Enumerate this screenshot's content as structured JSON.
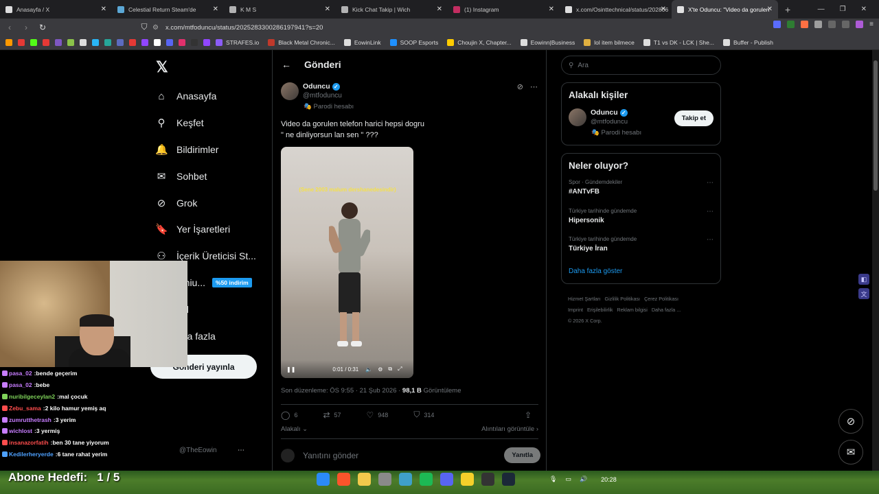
{
  "browser": {
    "tabs": [
      {
        "title": "Anasayfa / X",
        "icon": "x-logo-icon",
        "color": "#ffffff"
      },
      {
        "title": "Celestial Return Steam'de",
        "icon": "steam-icon",
        "color": "#66c0f4"
      },
      {
        "title": "K M S",
        "icon": "globe-icon",
        "color": "#cccccc"
      },
      {
        "title": "Kick Chat Takip | Wich",
        "icon": "globe-icon",
        "color": "#cccccc"
      },
      {
        "title": "(1) Instagram",
        "icon": "instagram-icon",
        "color": "#e1306c"
      },
      {
        "title": "x.com/Osinttechnical/status/202806",
        "icon": "x-logo-icon",
        "color": "#ffffff"
      },
      {
        "title": "X'te Oduncu: \"Video da gorulen",
        "icon": "x-logo-icon",
        "color": "#ffffff",
        "active": true
      }
    ],
    "url": "x.com/mtfoduncu/status/2025283300286197941?s=20",
    "bookmarks": [
      {
        "label": "STRAFES.io",
        "color": "#8b5cf6"
      },
      {
        "label": "Black Metal Chronic...",
        "color": "#c0392b"
      },
      {
        "label": "EowinLink",
        "color": "#dddddd"
      },
      {
        "label": "SOOP Esports",
        "color": "#1e90ff"
      },
      {
        "label": "Choujin X, Chapter...",
        "color": "#ffcc00"
      },
      {
        "label": "Eowinn|Business",
        "color": "#dddddd"
      },
      {
        "label": "lol item bilmece",
        "color": "#e0b040"
      },
      {
        "label": "T1 vs DK - LCK | She...",
        "color": "#dddddd"
      },
      {
        "label": "Buffer - Publish",
        "color": "#dddddd"
      }
    ]
  },
  "sidebar": {
    "items": [
      {
        "label": "Anasayfa",
        "icon": "home-icon",
        "glyph": "⌂"
      },
      {
        "label": "Keşfet",
        "icon": "search-icon",
        "glyph": "⚲"
      },
      {
        "label": "Bildirimler",
        "icon": "bell-icon",
        "glyph": "🔔"
      },
      {
        "label": "Sohbet",
        "icon": "mail-icon",
        "glyph": "✉"
      },
      {
        "label": "Grok",
        "icon": "grok-icon",
        "glyph": "⊘"
      },
      {
        "label": "Yer İşaretleri",
        "icon": "bookmark-icon",
        "glyph": "🔖"
      },
      {
        "label": "İçerik Üreticisi St...",
        "icon": "creator-icon",
        "glyph": "⚇"
      },
      {
        "label": "emiu...",
        "icon": "premium-icon",
        "glyph": "X",
        "badge": "%50 indirim"
      },
      {
        "label": "ofil",
        "icon": "profile-icon",
        "glyph": "☺"
      },
      {
        "label": "aha fazla",
        "icon": "more-icon",
        "glyph": "⋯"
      }
    ],
    "post_button": "Gönderi yayınla",
    "account_handle": "@TheEowin"
  },
  "main": {
    "header": "Gönderi",
    "author": {
      "name": "Oduncu",
      "handle": "@mtfoduncu",
      "parody": "Parodi hesabı"
    },
    "text": "Video da gorulen telefon harici hepsi dogru\n\" ne dinliyorsun lan sen \" ???",
    "video": {
      "caption": "(Sene 2003 malum dershanedesindir)",
      "time": "0:01 / 0:31"
    },
    "meta_date": "Son düzenleme: ÖS 9:55 · 21 Şub 2026 ·",
    "meta_views_count": "98,1 B",
    "meta_views_label": "Görüntüleme",
    "actions": {
      "replies": "6",
      "reposts": "57",
      "likes": "948",
      "bookmarks": "314"
    },
    "related_label": "Alakalı",
    "quotes_label": "Alıntıları görüntüle",
    "reply_placeholder": "Yanıtını gönder",
    "reply_button": "Yanıtla"
  },
  "right": {
    "search_placeholder": "Ara",
    "related_title": "Alakalı kişiler",
    "related_person": {
      "name": "Oduncu",
      "handle": "@mtfoduncu",
      "parody": "Parodi hesabı",
      "follow": "Takip et"
    },
    "trends_title": "Neler oluyor?",
    "trends": [
      {
        "category": "Spor · Gündemdekiler",
        "topic": "#ANTvFB"
      },
      {
        "category": "Türkiye tarihinde gündemde",
        "topic": "Hipersonik"
      },
      {
        "category": "Türkiye tarihinde gündemde",
        "topic": "Türkiye İran"
      }
    ],
    "show_more": "Daha fazla göster",
    "footer": [
      "Hizmet Şartları",
      "Gizlilik Politikası",
      "Çerez Politikası",
      "Imprint",
      "Erişilebilirlik",
      "Reklam bilgisi",
      "Daha fazla ...",
      "© 2026 X Corp."
    ]
  },
  "chat": {
    "lines": [
      {
        "user": "pasa_02",
        "msg": "bende geçerim",
        "color": "#c77dff"
      },
      {
        "user": "pasa_02",
        "msg": "bebe",
        "color": "#c77dff"
      },
      {
        "user": "nuribilgeceylan2",
        "msg": "mal çocuk",
        "color": "#7fd35a"
      },
      {
        "user": "Zebu_sama",
        "msg": "2 kilo hamur yemiş aq",
        "color": "#ff4d4d"
      },
      {
        "user": "zumrutthetrash",
        "msg": "3 yerim",
        "color": "#c77dff"
      },
      {
        "user": "wichlost",
        "msg": "3 yermiş",
        "color": "#c77dff"
      },
      {
        "user": "insanazorfatih",
        "msg": "ben 30 tane yiyorum",
        "color": "#ff4d4d"
      },
      {
        "user": "Kedilerheryerde",
        "msg": "6 tane rahat yerim",
        "color": "#4ea1ff"
      }
    ]
  },
  "overlay": {
    "goal_label": "Abone Hedefi:",
    "goal_value": "1 / 5"
  },
  "taskbar": {
    "clock": "20:28"
  }
}
